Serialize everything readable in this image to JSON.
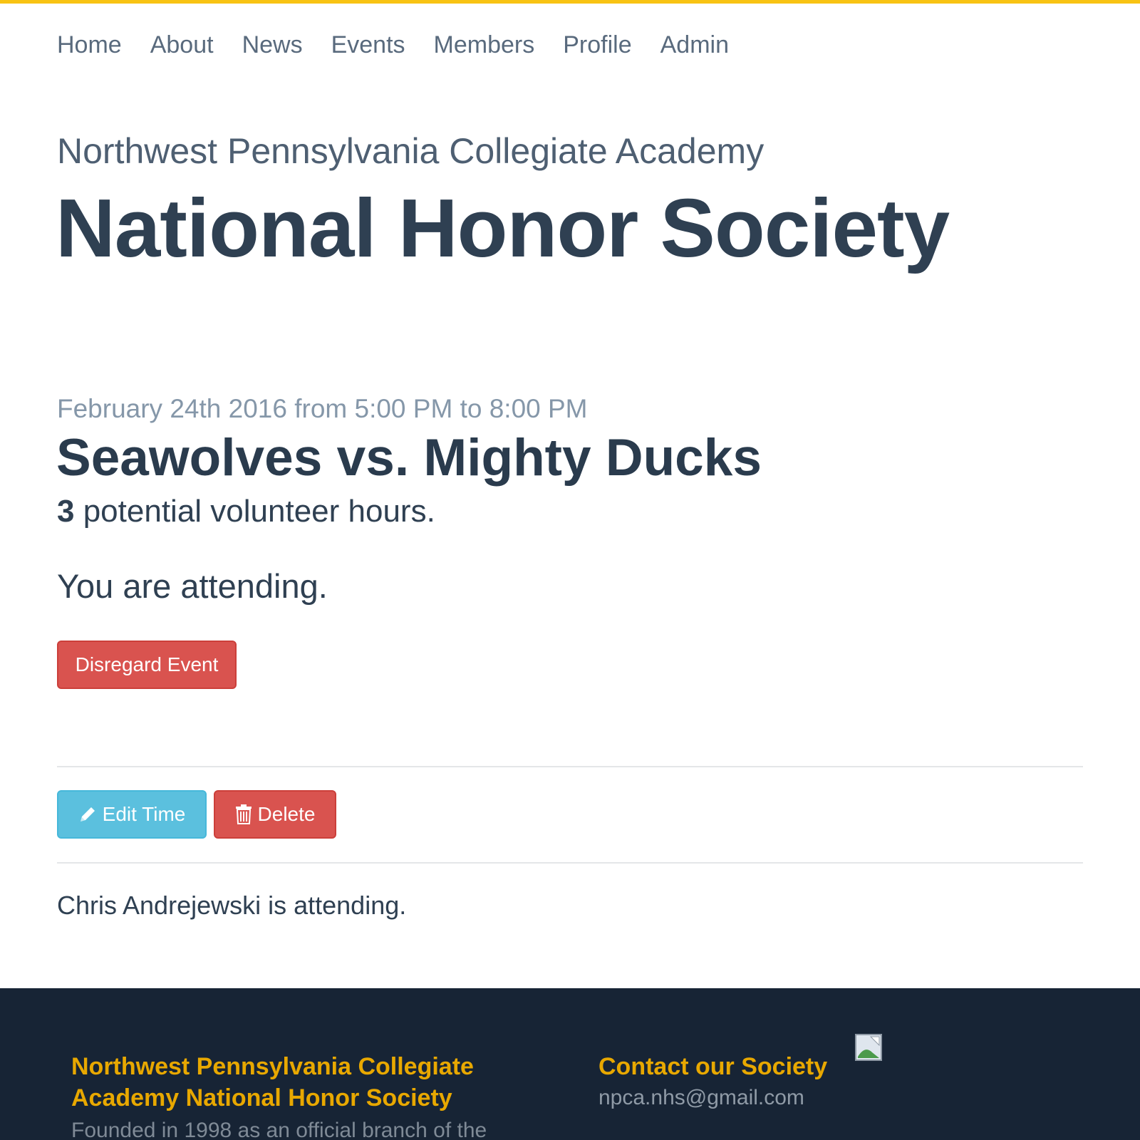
{
  "nav": {
    "items": [
      {
        "label": "Home"
      },
      {
        "label": "About"
      },
      {
        "label": "News"
      },
      {
        "label": "Events"
      },
      {
        "label": "Members"
      },
      {
        "label": "Profile"
      },
      {
        "label": "Admin"
      }
    ]
  },
  "header": {
    "school": "Northwest Pennsylvania Collegiate Academy",
    "title": "National Honor Society"
  },
  "event": {
    "date_line": "February 24th 2016 from 5:00 PM to 8:00 PM",
    "title": "Seawolves vs. Mighty Ducks",
    "hours_value": "3",
    "hours_suffix": " potential volunteer hours.",
    "status": "You are attending.",
    "disregard_label": "Disregard Event"
  },
  "admin": {
    "edit_label": "Edit Time",
    "delete_label": "Delete"
  },
  "attendees": [
    {
      "text": "Chris Andrejewski is attending."
    }
  ],
  "footer": {
    "org_title": "Northwest Pennsylvania Collegiate Academy National Honor Society",
    "description": "Founded in 1998 as an official branch of the",
    "contact_title": "Contact our Society",
    "email": "npca.nhs@gmail.com"
  },
  "colors": {
    "accent": "#f8c313",
    "danger": "#d9534f",
    "info": "#5bc0de",
    "footer_bg": "#172435",
    "footer_heading": "#e8a800"
  },
  "icons": {
    "edit": "pencil-icon",
    "delete": "trash-icon",
    "footer_image": "broken-image-icon"
  }
}
